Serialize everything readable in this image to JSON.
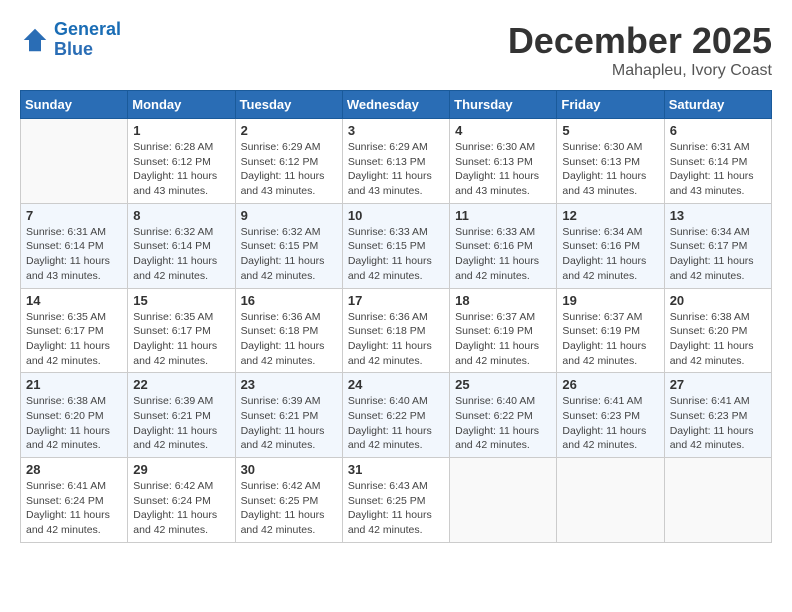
{
  "logo": {
    "line1": "General",
    "line2": "Blue"
  },
  "title": "December 2025",
  "location": "Mahapleu, Ivory Coast",
  "days_of_week": [
    "Sunday",
    "Monday",
    "Tuesday",
    "Wednesday",
    "Thursday",
    "Friday",
    "Saturday"
  ],
  "weeks": [
    [
      {
        "day": "",
        "info": ""
      },
      {
        "day": "1",
        "info": "Sunrise: 6:28 AM\nSunset: 6:12 PM\nDaylight: 11 hours and 43 minutes."
      },
      {
        "day": "2",
        "info": "Sunrise: 6:29 AM\nSunset: 6:12 PM\nDaylight: 11 hours and 43 minutes."
      },
      {
        "day": "3",
        "info": "Sunrise: 6:29 AM\nSunset: 6:13 PM\nDaylight: 11 hours and 43 minutes."
      },
      {
        "day": "4",
        "info": "Sunrise: 6:30 AM\nSunset: 6:13 PM\nDaylight: 11 hours and 43 minutes."
      },
      {
        "day": "5",
        "info": "Sunrise: 6:30 AM\nSunset: 6:13 PM\nDaylight: 11 hours and 43 minutes."
      },
      {
        "day": "6",
        "info": "Sunrise: 6:31 AM\nSunset: 6:14 PM\nDaylight: 11 hours and 43 minutes."
      }
    ],
    [
      {
        "day": "7",
        "info": "Sunrise: 6:31 AM\nSunset: 6:14 PM\nDaylight: 11 hours and 43 minutes."
      },
      {
        "day": "8",
        "info": "Sunrise: 6:32 AM\nSunset: 6:14 PM\nDaylight: 11 hours and 42 minutes."
      },
      {
        "day": "9",
        "info": "Sunrise: 6:32 AM\nSunset: 6:15 PM\nDaylight: 11 hours and 42 minutes."
      },
      {
        "day": "10",
        "info": "Sunrise: 6:33 AM\nSunset: 6:15 PM\nDaylight: 11 hours and 42 minutes."
      },
      {
        "day": "11",
        "info": "Sunrise: 6:33 AM\nSunset: 6:16 PM\nDaylight: 11 hours and 42 minutes."
      },
      {
        "day": "12",
        "info": "Sunrise: 6:34 AM\nSunset: 6:16 PM\nDaylight: 11 hours and 42 minutes."
      },
      {
        "day": "13",
        "info": "Sunrise: 6:34 AM\nSunset: 6:17 PM\nDaylight: 11 hours and 42 minutes."
      }
    ],
    [
      {
        "day": "14",
        "info": "Sunrise: 6:35 AM\nSunset: 6:17 PM\nDaylight: 11 hours and 42 minutes."
      },
      {
        "day": "15",
        "info": "Sunrise: 6:35 AM\nSunset: 6:17 PM\nDaylight: 11 hours and 42 minutes."
      },
      {
        "day": "16",
        "info": "Sunrise: 6:36 AM\nSunset: 6:18 PM\nDaylight: 11 hours and 42 minutes."
      },
      {
        "day": "17",
        "info": "Sunrise: 6:36 AM\nSunset: 6:18 PM\nDaylight: 11 hours and 42 minutes."
      },
      {
        "day": "18",
        "info": "Sunrise: 6:37 AM\nSunset: 6:19 PM\nDaylight: 11 hours and 42 minutes."
      },
      {
        "day": "19",
        "info": "Sunrise: 6:37 AM\nSunset: 6:19 PM\nDaylight: 11 hours and 42 minutes."
      },
      {
        "day": "20",
        "info": "Sunrise: 6:38 AM\nSunset: 6:20 PM\nDaylight: 11 hours and 42 minutes."
      }
    ],
    [
      {
        "day": "21",
        "info": "Sunrise: 6:38 AM\nSunset: 6:20 PM\nDaylight: 11 hours and 42 minutes."
      },
      {
        "day": "22",
        "info": "Sunrise: 6:39 AM\nSunset: 6:21 PM\nDaylight: 11 hours and 42 minutes."
      },
      {
        "day": "23",
        "info": "Sunrise: 6:39 AM\nSunset: 6:21 PM\nDaylight: 11 hours and 42 minutes."
      },
      {
        "day": "24",
        "info": "Sunrise: 6:40 AM\nSunset: 6:22 PM\nDaylight: 11 hours and 42 minutes."
      },
      {
        "day": "25",
        "info": "Sunrise: 6:40 AM\nSunset: 6:22 PM\nDaylight: 11 hours and 42 minutes."
      },
      {
        "day": "26",
        "info": "Sunrise: 6:41 AM\nSunset: 6:23 PM\nDaylight: 11 hours and 42 minutes."
      },
      {
        "day": "27",
        "info": "Sunrise: 6:41 AM\nSunset: 6:23 PM\nDaylight: 11 hours and 42 minutes."
      }
    ],
    [
      {
        "day": "28",
        "info": "Sunrise: 6:41 AM\nSunset: 6:24 PM\nDaylight: 11 hours and 42 minutes."
      },
      {
        "day": "29",
        "info": "Sunrise: 6:42 AM\nSunset: 6:24 PM\nDaylight: 11 hours and 42 minutes."
      },
      {
        "day": "30",
        "info": "Sunrise: 6:42 AM\nSunset: 6:25 PM\nDaylight: 11 hours and 42 minutes."
      },
      {
        "day": "31",
        "info": "Sunrise: 6:43 AM\nSunset: 6:25 PM\nDaylight: 11 hours and 42 minutes."
      },
      {
        "day": "",
        "info": ""
      },
      {
        "day": "",
        "info": ""
      },
      {
        "day": "",
        "info": ""
      }
    ]
  ]
}
